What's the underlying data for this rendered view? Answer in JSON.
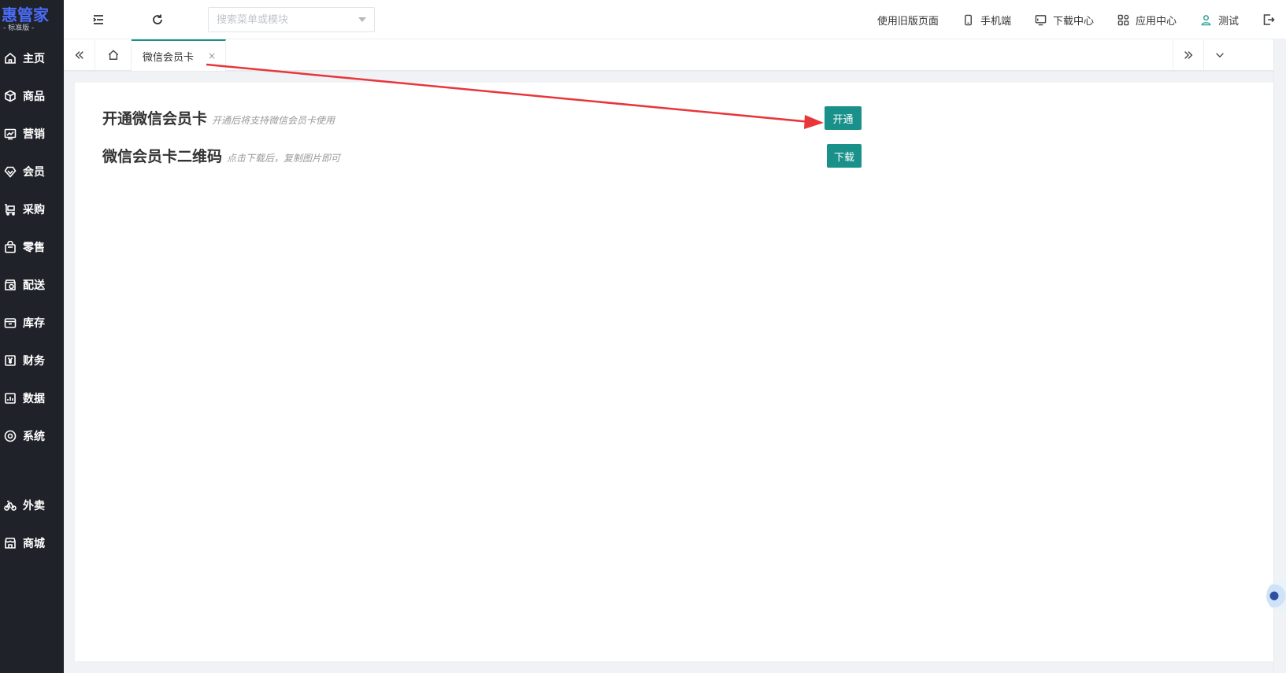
{
  "logo": {
    "title": "惠管家",
    "subtitle": "- 标准版 -"
  },
  "sidebar": {
    "items": [
      {
        "label": "主页",
        "icon": "home-icon"
      },
      {
        "label": "商品",
        "icon": "box-icon"
      },
      {
        "label": "营销",
        "icon": "chart-icon"
      },
      {
        "label": "会员",
        "icon": "diamond-icon"
      },
      {
        "label": "采购",
        "icon": "cart-icon"
      },
      {
        "label": "零售",
        "icon": "bag-icon"
      },
      {
        "label": "配送",
        "icon": "store-icon"
      },
      {
        "label": "库存",
        "icon": "archive-icon"
      },
      {
        "label": "财务",
        "icon": "yen-icon"
      },
      {
        "label": "数据",
        "icon": "bars-icon"
      },
      {
        "label": "系统",
        "icon": "settings-icon"
      },
      {
        "label": "外卖",
        "icon": "bike-icon"
      },
      {
        "label": "商城",
        "icon": "shop-icon"
      }
    ]
  },
  "header": {
    "search_placeholder": "搜索菜单或模块",
    "old_page": "使用旧版页面",
    "mobile": "手机端",
    "download_center": "下载中心",
    "app_center": "应用中心",
    "user": "测试"
  },
  "tabs": {
    "active_label": "微信会员卡",
    "close_glyph": "×"
  },
  "main": {
    "row1": {
      "title": "开通微信会员卡",
      "hint": "开通后将支持微信会员卡使用",
      "button": "开通"
    },
    "row2": {
      "title": "微信会员卡二维码",
      "hint": "点击下载后，复制图片即可",
      "button": "下载"
    }
  },
  "colors": {
    "sidebar_bg": "#20222a",
    "accent": "#19918a",
    "logo": "#4a6cf7",
    "arrow": "#e8363a"
  }
}
